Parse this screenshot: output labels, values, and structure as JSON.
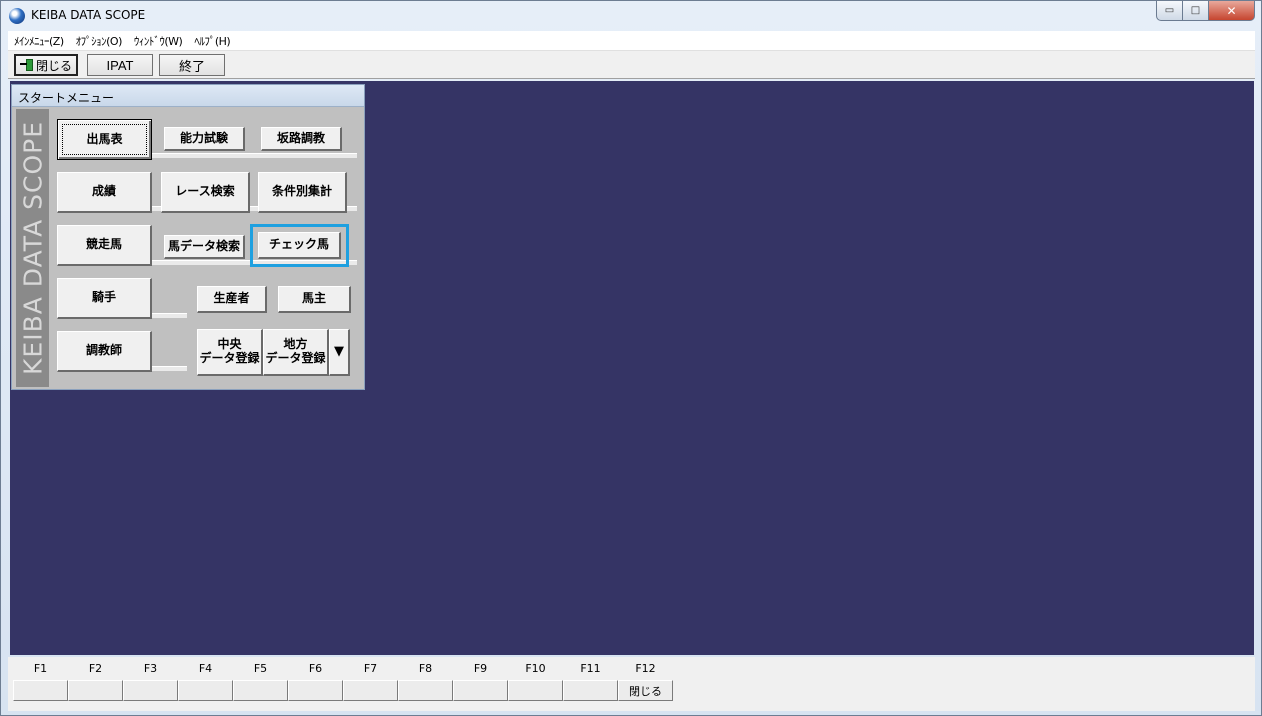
{
  "window": {
    "title": "KEIBA DATA SCOPE"
  },
  "window_controls": {
    "minimize": "▭",
    "maximize": "□",
    "close": "✕"
  },
  "menubar": [
    "ﾒｲﾝﾒﾆｭｰ(Z)",
    "ｵﾌﾟｼｮﾝ(O)",
    "ｳｨﾝﾄﾞｳ(W)",
    "ﾍﾙﾌﾟ(H)"
  ],
  "toolbar": {
    "close_label": "閉じる",
    "ipat_label": "IPAT",
    "exit_label": "終了"
  },
  "start_menu": {
    "title": "スタートメニュー",
    "side_label": "KEIBA DATA SCOPE",
    "buttons": {
      "entries": "出馬表",
      "ability_test": "能力試験",
      "slope_training": "坂路調教",
      "results": "成績",
      "race_search": "レース検索",
      "conditional_stats": "条件別集計",
      "racehorse": "競走馬",
      "horse_data_search": "馬データ検索",
      "check_horse": "チェック馬",
      "jockey": "騎手",
      "breeder": "生産者",
      "owner": "馬主",
      "trainer": "調教師",
      "central_register_1": "中央",
      "central_register_2": "データ登録",
      "local_register_1": "地方",
      "local_register_2": "データ登録",
      "more_arrow": "▼"
    }
  },
  "fkeys": {
    "labels": [
      "F1",
      "F2",
      "F3",
      "F4",
      "F5",
      "F6",
      "F7",
      "F8",
      "F9",
      "F10",
      "F11",
      "F12"
    ],
    "values": [
      "",
      "",
      "",
      "",
      "",
      "",
      "",
      "",
      "",
      "",
      "",
      "閉じる"
    ]
  }
}
